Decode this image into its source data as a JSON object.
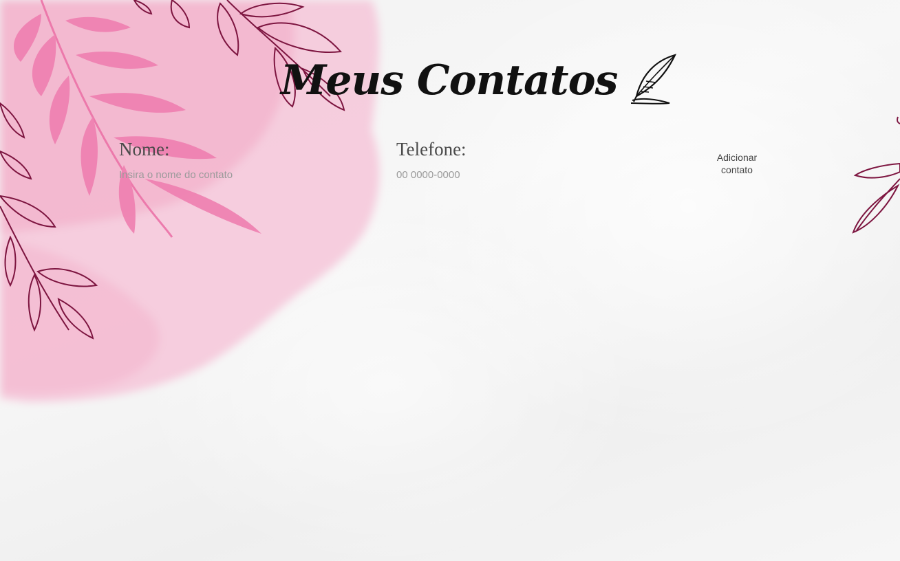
{
  "header": {
    "title": "Meus Contatos",
    "title_icon": "quill-pen-icon"
  },
  "form": {
    "name_label": "Nome:",
    "name_placeholder": "Insira o nome do contato",
    "phone_label": "Telefone:",
    "phone_placeholder": "00 0000-0000",
    "add_button_label": "Adicionar contato"
  },
  "colors": {
    "watercolor_pink": "#f3b7cf",
    "leaf_pink": "#ef7fb0",
    "leaf_outline": "#7d1540",
    "background": "#f5f5f5"
  }
}
